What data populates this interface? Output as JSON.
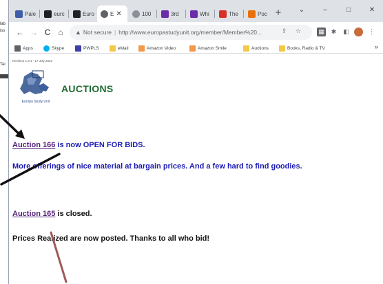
{
  "background_window": {
    "fragments": [
      "lab",
      "iss",
      "Tai"
    ]
  },
  "tabs": [
    {
      "label": "Pale",
      "favicon_color": "#3f5ea8"
    },
    {
      "label": "eurc",
      "favicon_color": "#202124"
    },
    {
      "label": "Euro",
      "favicon_color": "#202124"
    },
    {
      "label": "E",
      "favicon_color": "#5f6368",
      "active": true
    },
    {
      "label": "100",
      "favicon_color": "#8a8f98"
    },
    {
      "label": "3rd",
      "favicon_color": "#6a2ca8"
    },
    {
      "label": "Whi",
      "favicon_color": "#6a2ca8"
    },
    {
      "label": "The",
      "favicon_color": "#d93025"
    },
    {
      "label": "Poc",
      "favicon_color": "#e8710a"
    }
  ],
  "window_controls": {
    "dropdown": "⌄",
    "minimize": "–",
    "maximize": "□",
    "close": "✕"
  },
  "toolbar": {
    "back": "←",
    "forward": "→",
    "reload": "C",
    "home": "⌂",
    "warning_glyph": "▲",
    "security_label": "Not secure",
    "url": "http://www.europastudyunit.org/member/Member%20..."
  },
  "bookmarks": [
    {
      "label": "Apps",
      "icon_color": "#5f6368"
    },
    {
      "label": "Skype",
      "icon_color": "#00aff0"
    },
    {
      "label": "PWPLS",
      "icon_color": "#3f3fa8"
    },
    {
      "label": "eMail",
      "icon_color": "#f2c94c"
    },
    {
      "label": "Amazon Video",
      "icon_color": "#f2994a"
    },
    {
      "label": "Amazon Smile",
      "icon_color": "#f2994a"
    },
    {
      "label": "Auctions",
      "icon_color": "#f2c94c"
    },
    {
      "label": "Books, Radio & TV",
      "icon_color": "#f2c94c"
    }
  ],
  "bookmarks_more": "»",
  "page": {
    "revision": "Revision 1.9.1 · 17 July 2023",
    "logo_caption": "Europa Study Unit",
    "title": "AUCTIONS",
    "open_auction_link": "Auction 166",
    "open_auction_text": " is now OPEN FOR BIDS.",
    "open_auction_detail": "More offerings of nice material at bargain prices. And a few hard to find goodies.",
    "closed_auction_link": "Auction 165",
    "closed_auction_text": " is closed.",
    "closed_auction_detail": "Prices Realized are now posted. Thanks to all who bid!"
  },
  "colors": {
    "title_green": "#1d6b2f",
    "link_purple": "#55207a",
    "open_text_blue": "#1b1bb5",
    "annotation_black": "#111111",
    "annotation_red": "#9e5a5a"
  }
}
